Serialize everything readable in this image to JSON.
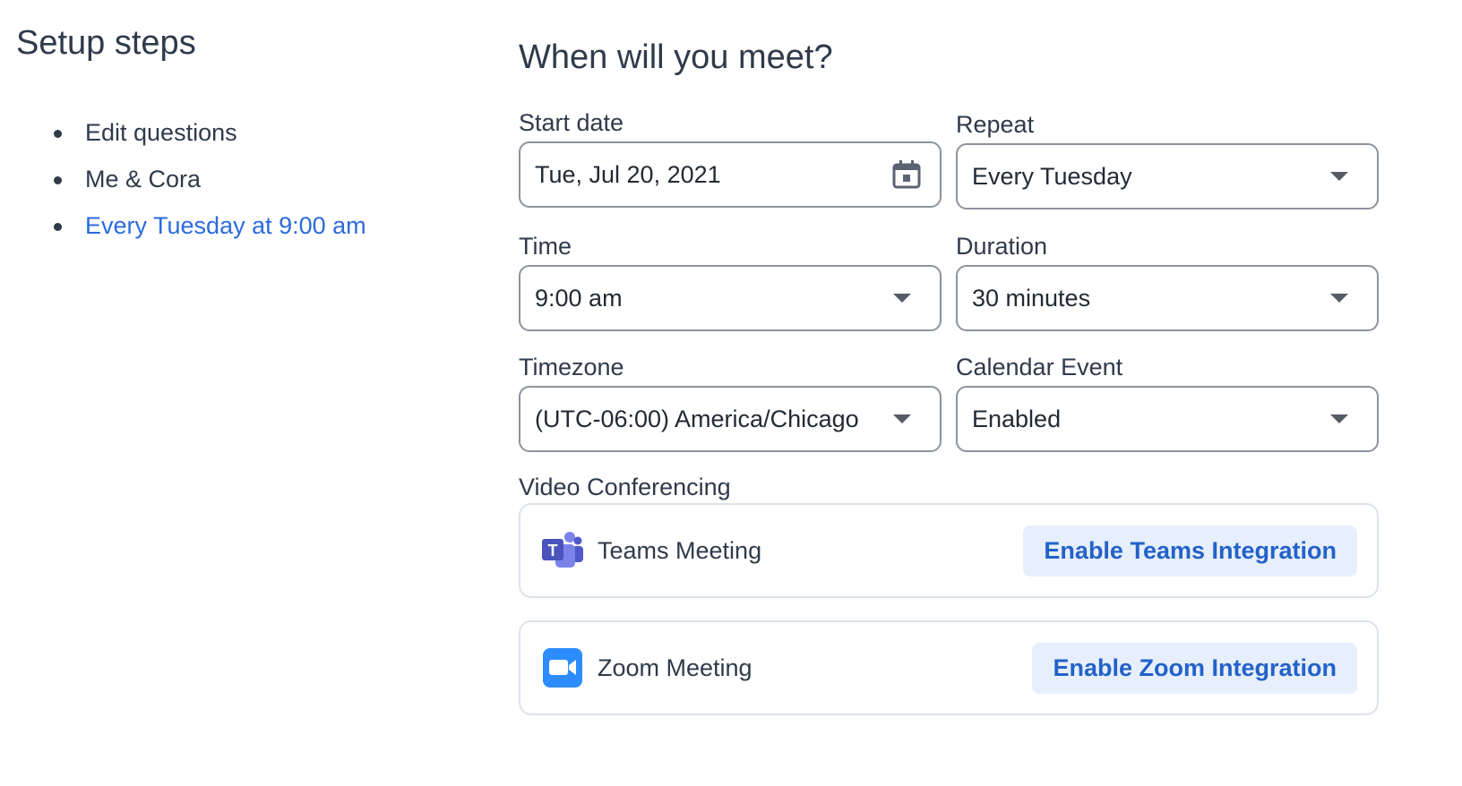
{
  "sidebar": {
    "title": "Setup steps",
    "steps": [
      {
        "label": "Edit questions"
      },
      {
        "label": "Me & Cora"
      },
      {
        "label": "Every Tuesday at 9:00 am"
      }
    ]
  },
  "main": {
    "title": "When will you meet?",
    "start_date": {
      "label": "Start date",
      "value": "Tue, Jul 20, 2021"
    },
    "repeat": {
      "label": "Repeat",
      "value": "Every Tuesday"
    },
    "time": {
      "label": "Time",
      "value": "9:00 am"
    },
    "duration": {
      "label": "Duration",
      "value": "30 minutes"
    },
    "timezone": {
      "label": "Timezone",
      "value": "(UTC-06:00) America/Chicago"
    },
    "calendar_event": {
      "label": "Calendar Event",
      "value": "Enabled"
    },
    "video_conferencing": {
      "label": "Video Conferencing",
      "teams": {
        "name": "Teams Meeting",
        "button": "Enable Teams Integration",
        "icon": "teams-icon"
      },
      "zoom": {
        "name": "Zoom Meeting",
        "button": "Enable Zoom Integration",
        "icon": "zoom-icon"
      }
    }
  },
  "colors": {
    "accent": "#2b6bde",
    "button_bg": "#e7effc",
    "button_text": "#2362c9",
    "border": "#8d939c"
  }
}
